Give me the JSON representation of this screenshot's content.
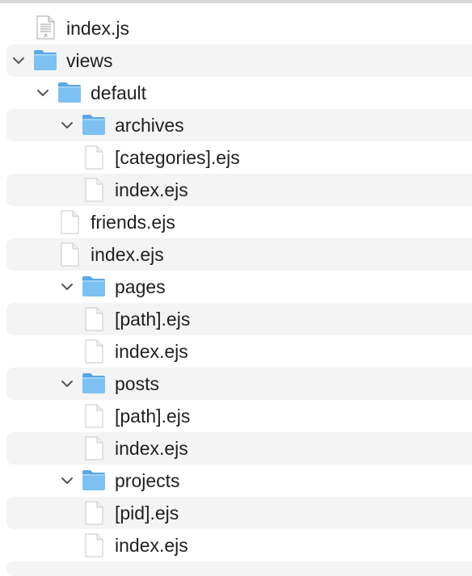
{
  "tree": [
    {
      "name": "index.js",
      "type": "js",
      "depth": 0,
      "stripe": false
    },
    {
      "name": "views",
      "type": "folder",
      "depth": 0,
      "stripe": true,
      "expanded": true
    },
    {
      "name": "default",
      "type": "folder",
      "depth": 1,
      "stripe": false,
      "expanded": true
    },
    {
      "name": "archives",
      "type": "folder",
      "depth": 2,
      "stripe": true,
      "expanded": true
    },
    {
      "name": "[categories].ejs",
      "type": "file",
      "depth": 3,
      "stripe": false
    },
    {
      "name": "index.ejs",
      "type": "file",
      "depth": 3,
      "stripe": true
    },
    {
      "name": "friends.ejs",
      "type": "file",
      "depth": 2,
      "stripe": false
    },
    {
      "name": "index.ejs",
      "type": "file",
      "depth": 2,
      "stripe": true
    },
    {
      "name": "pages",
      "type": "folder",
      "depth": 2,
      "stripe": false,
      "expanded": true
    },
    {
      "name": "[path].ejs",
      "type": "file",
      "depth": 3,
      "stripe": true
    },
    {
      "name": "index.ejs",
      "type": "file",
      "depth": 3,
      "stripe": false
    },
    {
      "name": "posts",
      "type": "folder",
      "depth": 2,
      "stripe": true,
      "expanded": true
    },
    {
      "name": "[path].ejs",
      "type": "file",
      "depth": 3,
      "stripe": false
    },
    {
      "name": "index.ejs",
      "type": "file",
      "depth": 3,
      "stripe": true
    },
    {
      "name": "projects",
      "type": "folder",
      "depth": 2,
      "stripe": false,
      "expanded": true
    },
    {
      "name": "[pid].ejs",
      "type": "file",
      "depth": 3,
      "stripe": true
    },
    {
      "name": "index.ejs",
      "type": "file",
      "depth": 3,
      "stripe": false
    }
  ],
  "colors": {
    "folder_front": "#7cc1f2",
    "folder_back": "#5aa7e6",
    "stripe": "#f4f4f4",
    "text": "#1f1f1f",
    "chevron": "#555555"
  }
}
